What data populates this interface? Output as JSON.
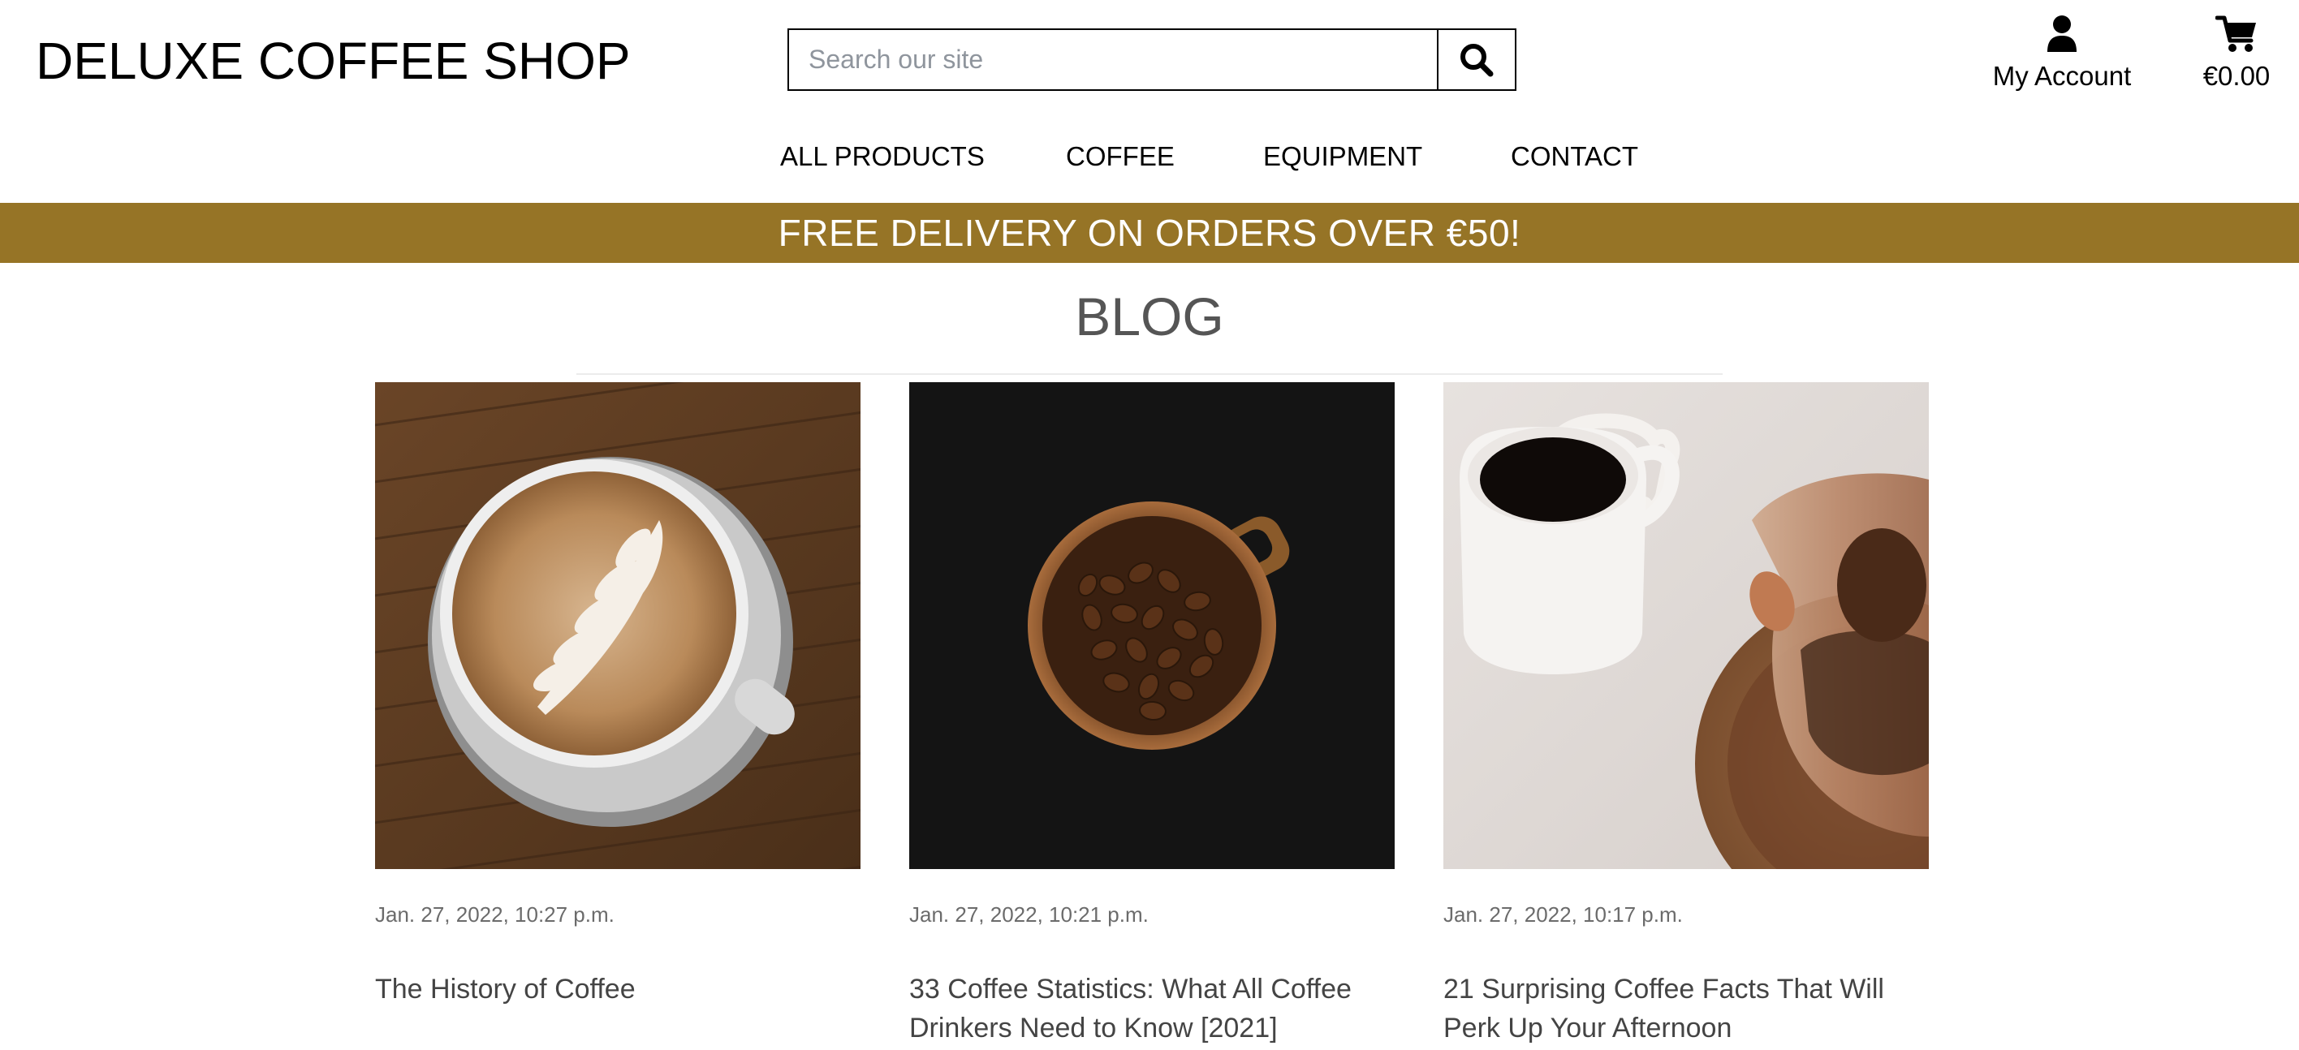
{
  "header": {
    "brand": "DELUXE COFFEE SHOP",
    "search": {
      "placeholder": "Search our site",
      "value": ""
    },
    "account_label": "My Account",
    "cart_total": "€0.00"
  },
  "nav": {
    "items": [
      {
        "label": "ALL PRODUCTS"
      },
      {
        "label": "COFFEE"
      },
      {
        "label": "EQUIPMENT"
      },
      {
        "label": "CONTACT"
      }
    ]
  },
  "banner": {
    "text": "FREE DELIVERY ON ORDERS OVER €50!"
  },
  "main": {
    "title": "BLOG",
    "posts": [
      {
        "date": "Jan. 27, 2022, 10:27 p.m.",
        "title": "The History of Coffee"
      },
      {
        "date": "Jan. 27, 2022, 10:21 p.m.",
        "title": "33 Coffee Statistics: What All Coffee Drinkers Need to Know [2021]"
      },
      {
        "date": "Jan. 27, 2022, 10:17 p.m.",
        "title": "21 Surprising Coffee Facts That Will Perk Up Your Afternoon"
      }
    ]
  },
  "icons": {
    "search": "search-icon",
    "account": "user-icon",
    "cart": "shopping-cart-icon"
  },
  "colors": {
    "banner_background": "#967426",
    "banner_text": "#ffffff",
    "title_text": "#555555"
  }
}
